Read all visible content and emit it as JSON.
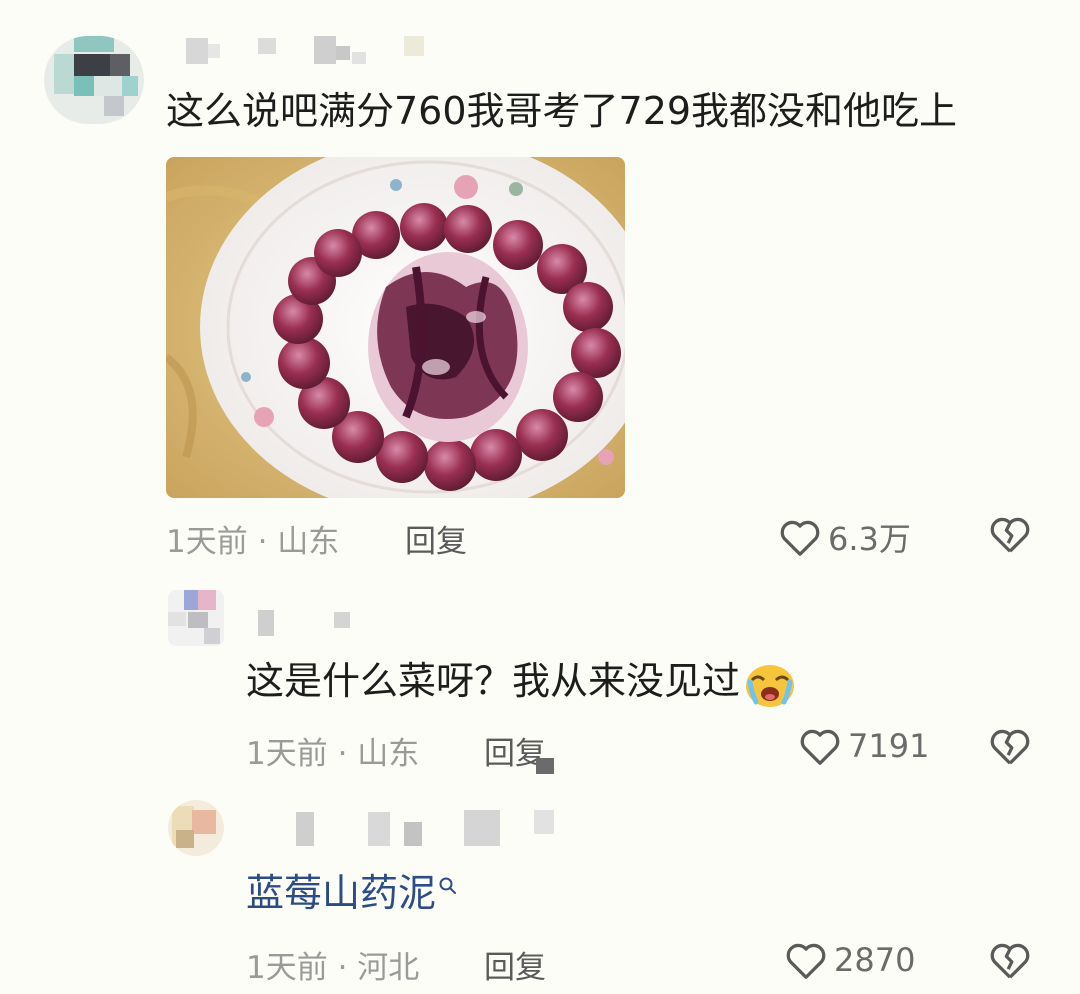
{
  "comments": [
    {
      "text": "这么说吧满分760我哥考了729我都没和他吃上",
      "time_location": "1天前 · 山东",
      "reply_label": "回复",
      "likes": "6.3万",
      "has_image": true
    },
    {
      "text": "这是什么菜呀？我从来没见过",
      "emoji": "crying-face-emoji",
      "time_location": "1天前 · 山东",
      "reply_label": "回复",
      "likes": "7191"
    },
    {
      "text": "蓝莓山药泥",
      "search_icon": "search-icon",
      "time_location": "1天前 · 河北",
      "reply_label": "回复",
      "likes": "2870"
    }
  ],
  "icons": {
    "like": "heart-outline-icon",
    "dislike": "broken-heart-icon"
  },
  "colors": {
    "background": "#fdfdf8",
    "meta_text": "#9a9a9a",
    "link_text": "#2d4c86"
  }
}
